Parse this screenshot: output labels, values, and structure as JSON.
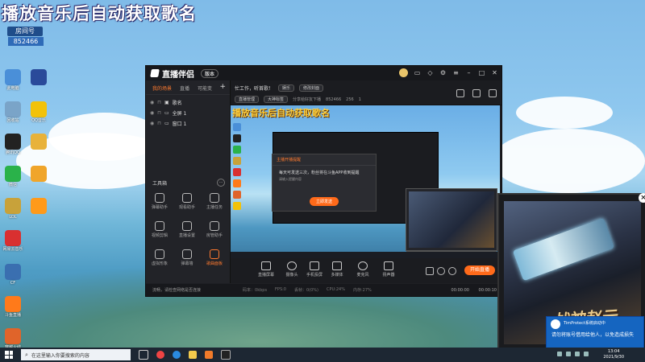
{
  "overlay": {
    "title": "播放音乐后自动获取歌名",
    "room_badge": "房间号",
    "room_id": "852466"
  },
  "desktop_icons": [
    {
      "label": "此电脑",
      "color": "#4a8fd8"
    },
    {
      "label": "我的电脑",
      "color": "#5fa0e0"
    },
    {
      "label": "回收站",
      "color": "#7aa4c8"
    },
    {
      "label": "腾讯QQ",
      "color": "#222222"
    },
    {
      "label": "微信",
      "color": "#2ab24a"
    },
    {
      "label": "LOL",
      "color": "#c8a23a"
    },
    {
      "label": "网易云音乐",
      "color": "#d93030"
    },
    {
      "label": "CF",
      "color": "#3a6fb0"
    },
    {
      "label": "斗鱼直播",
      "color": "#ff7a1a"
    },
    {
      "label": "穿越火线",
      "color": "#e0642a"
    }
  ],
  "desktop_icons_right": [
    {
      "label": "",
      "color": "#2a4a9a"
    },
    {
      "label": "QQ音乐",
      "color": "#f2c20a"
    },
    {
      "label": "",
      "color": "#e8b23a"
    },
    {
      "label": "",
      "color": "#f0a52a"
    },
    {
      "label": "",
      "color": "#ff9a1a"
    }
  ],
  "app": {
    "logo": "直播伴侣",
    "version": "版本",
    "tabs": [
      "我的场景",
      "直播",
      "可能变"
    ],
    "sources": [
      {
        "name": "歌名"
      },
      {
        "name": "全屏 1"
      },
      {
        "name": "窗口 1"
      }
    ],
    "tools_title": "工具箱",
    "tools": [
      {
        "label": "弹幕助手"
      },
      {
        "label": "观看助手"
      },
      {
        "label": "主播任务"
      },
      {
        "label": "视频剪辑"
      },
      {
        "label": "直播设置"
      },
      {
        "label": "房管助手"
      },
      {
        "label": "虚拟形象"
      },
      {
        "label": "弹幕墙"
      },
      {
        "label": "歌曲面板"
      }
    ],
    "info_title": "忙工作，听首歌！",
    "info_tag": "娱乐",
    "info_edit": "修改封面",
    "info_row2": [
      "直播管理",
      "大神标签",
      "分享给好友下播",
      "852466",
      "256",
      "1"
    ],
    "preview_title": "播放音乐后自动获取歌名",
    "dialog_header": "主播开播提醒",
    "dialog_body": "每天可发送三次，粉丝将在斗鱼APP收到提醒",
    "dialog_sub": "请输入提醒内容",
    "dialog_button": "立即发送",
    "bottom_items": [
      "直播屏幕",
      "摄像头",
      "手机投屏",
      "多媒体",
      "麦克风",
      "扬声器"
    ],
    "live_button": "开始直播",
    "status_left": "流畅，请检查网络是否连接",
    "status_stats": [
      "码率：0kbps",
      "FPS:0",
      "丢帧：0(0%)",
      "CPU:24%",
      "内存:27%"
    ],
    "time_left": "00:00:00",
    "time_right": "00:00:10"
  },
  "popup_game": {
    "title": "战神赵云"
  },
  "toast": {
    "header": "TimProtect系统启动中",
    "body": "请勿将账号借用给他人，以免造成损失"
  },
  "taskbar": {
    "search_placeholder": "在这里输入你要搜索的内容",
    "time": "13:04",
    "date": "2021/9/30"
  }
}
